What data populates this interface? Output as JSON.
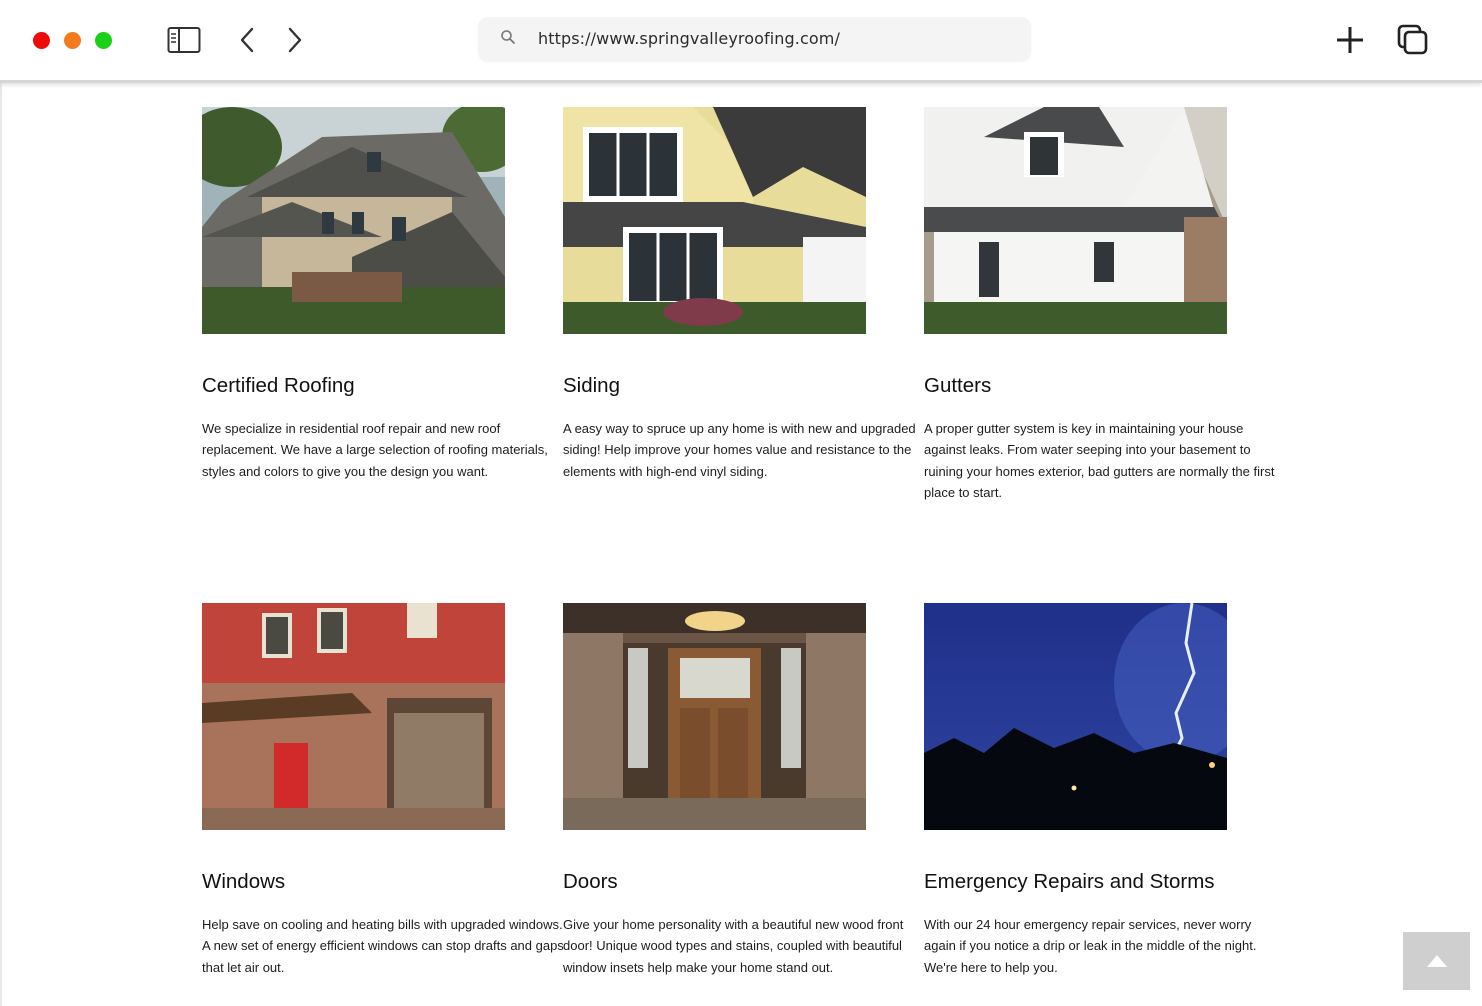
{
  "browser": {
    "url": "https://www.springvalleyroofing.com/"
  },
  "services": [
    {
      "title": "Certified Roofing",
      "description": "We specialize in residential roof repair and new roof replacement.  We have a large selection of roofing materials, styles and colors to give you the design you want."
    },
    {
      "title": "Siding",
      "description": "A easy way to spruce up any home is with new and upgraded siding!  Help improve your homes value and resistance to the elements with high-end vinyl siding."
    },
    {
      "title": "Gutters",
      "description": "A proper gutter system is key in maintaining your house against leaks.  From water seeping into your basement to ruining your homes exterior, bad gutters are normally the first place to start."
    },
    {
      "title": "Windows",
      "description": "Help save on cooling and heating bills with upgraded windows.  A new set of energy efficient windows can stop drafts and gaps that let air out."
    },
    {
      "title": "Doors",
      "description": "Give your home personality with a beautiful new wood front door!  Unique wood types and stains, coupled with beautiful window insets help make your home stand out."
    },
    {
      "title": "Emergency Repairs and Storms",
      "description": "With our 24 hour emergency repair services, never worry again if you notice a drip or leak in the middle of the night.  We're here to help you."
    }
  ],
  "icons": {
    "back_to_top": "chevron-up-icon"
  }
}
